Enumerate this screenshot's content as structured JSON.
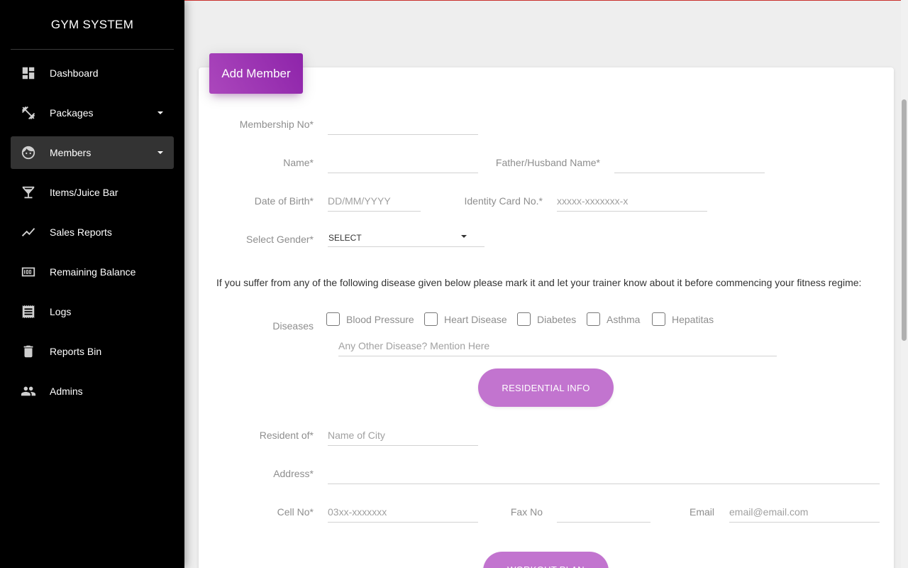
{
  "sidebar": {
    "brand": "GYM SYSTEM",
    "items": [
      {
        "label": "Dashboard",
        "icon": "dashboard-icon"
      },
      {
        "label": "Packages",
        "icon": "fitness-icon"
      },
      {
        "label": "Members",
        "icon": "face-icon"
      },
      {
        "label": "Items/Juice Bar",
        "icon": "cocktail-icon"
      },
      {
        "label": "Sales Reports",
        "icon": "trending-up-icon"
      },
      {
        "label": "Remaining Balance",
        "icon": "counter-icon"
      },
      {
        "label": "Logs",
        "icon": "receipt-icon"
      },
      {
        "label": "Reports Bin",
        "icon": "trash-icon"
      },
      {
        "label": "Admins",
        "icon": "people-icon"
      }
    ]
  },
  "form": {
    "title": "Add Member",
    "membership_no": {
      "label": "Membership No*",
      "placeholder": ""
    },
    "name": {
      "label": "Name*",
      "placeholder": ""
    },
    "father_name": {
      "label": "Father/Husband Name*",
      "placeholder": ""
    },
    "dob": {
      "label": "Date of Birth*",
      "placeholder": "DD/MM/YYYY"
    },
    "identity": {
      "label": "Identity Card No.*",
      "placeholder": "xxxxx-xxxxxxx-x"
    },
    "gender": {
      "label": "Select Gender*",
      "value": "SELECT"
    },
    "notice": "If you suffer from any of the following disease given below please mark it and let your trainer know about it before commencing your fitness regime:",
    "diseases": {
      "label": "Diseases",
      "options": [
        "Blood Pressure",
        "Heart Disease",
        "Diabetes",
        "Asthma",
        "Hepatitas"
      ],
      "other_placeholder": "Any Other Disease? Mention Here"
    },
    "residential_button": "RESIDENTIAL INFO",
    "resident_of": {
      "label": "Resident of*",
      "placeholder": "Name of City"
    },
    "address": {
      "label": "Address*",
      "placeholder": ""
    },
    "cell": {
      "label": "Cell No*",
      "placeholder": "03xx-xxxxxxx"
    },
    "fax": {
      "label": "Fax No",
      "placeholder": ""
    },
    "email": {
      "label": "Email",
      "placeholder": "email@email.com"
    },
    "workout_button": "WORKOUT PLAN"
  },
  "colors": {
    "accent": "#9c27b0",
    "pill": "#c274cf",
    "sidebar_bg": "#000000",
    "active_item": "#333333"
  }
}
